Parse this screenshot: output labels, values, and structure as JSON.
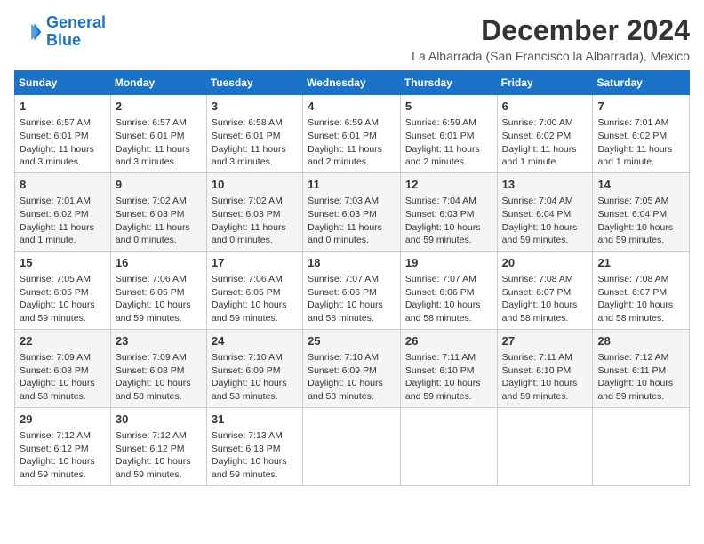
{
  "header": {
    "logo_line1": "General",
    "logo_line2": "Blue",
    "month_title": "December 2024",
    "location": "La Albarrada (San Francisco la Albarrada), Mexico"
  },
  "weekdays": [
    "Sunday",
    "Monday",
    "Tuesday",
    "Wednesday",
    "Thursday",
    "Friday",
    "Saturday"
  ],
  "weeks": [
    [
      {
        "day": "1",
        "sunrise": "6:57 AM",
        "sunset": "6:01 PM",
        "daylight": "11 hours and 3 minutes."
      },
      {
        "day": "2",
        "sunrise": "6:57 AM",
        "sunset": "6:01 PM",
        "daylight": "11 hours and 3 minutes."
      },
      {
        "day": "3",
        "sunrise": "6:58 AM",
        "sunset": "6:01 PM",
        "daylight": "11 hours and 3 minutes."
      },
      {
        "day": "4",
        "sunrise": "6:59 AM",
        "sunset": "6:01 PM",
        "daylight": "11 hours and 2 minutes."
      },
      {
        "day": "5",
        "sunrise": "6:59 AM",
        "sunset": "6:01 PM",
        "daylight": "11 hours and 2 minutes."
      },
      {
        "day": "6",
        "sunrise": "7:00 AM",
        "sunset": "6:02 PM",
        "daylight": "11 hours and 1 minute."
      },
      {
        "day": "7",
        "sunrise": "7:01 AM",
        "sunset": "6:02 PM",
        "daylight": "11 hours and 1 minute."
      }
    ],
    [
      {
        "day": "8",
        "sunrise": "7:01 AM",
        "sunset": "6:02 PM",
        "daylight": "11 hours and 1 minute."
      },
      {
        "day": "9",
        "sunrise": "7:02 AM",
        "sunset": "6:03 PM",
        "daylight": "11 hours and 0 minutes."
      },
      {
        "day": "10",
        "sunrise": "7:02 AM",
        "sunset": "6:03 PM",
        "daylight": "11 hours and 0 minutes."
      },
      {
        "day": "11",
        "sunrise": "7:03 AM",
        "sunset": "6:03 PM",
        "daylight": "11 hours and 0 minutes."
      },
      {
        "day": "12",
        "sunrise": "7:04 AM",
        "sunset": "6:03 PM",
        "daylight": "10 hours and 59 minutes."
      },
      {
        "day": "13",
        "sunrise": "7:04 AM",
        "sunset": "6:04 PM",
        "daylight": "10 hours and 59 minutes."
      },
      {
        "day": "14",
        "sunrise": "7:05 AM",
        "sunset": "6:04 PM",
        "daylight": "10 hours and 59 minutes."
      }
    ],
    [
      {
        "day": "15",
        "sunrise": "7:05 AM",
        "sunset": "6:05 PM",
        "daylight": "10 hours and 59 minutes."
      },
      {
        "day": "16",
        "sunrise": "7:06 AM",
        "sunset": "6:05 PM",
        "daylight": "10 hours and 59 minutes."
      },
      {
        "day": "17",
        "sunrise": "7:06 AM",
        "sunset": "6:05 PM",
        "daylight": "10 hours and 59 minutes."
      },
      {
        "day": "18",
        "sunrise": "7:07 AM",
        "sunset": "6:06 PM",
        "daylight": "10 hours and 58 minutes."
      },
      {
        "day": "19",
        "sunrise": "7:07 AM",
        "sunset": "6:06 PM",
        "daylight": "10 hours and 58 minutes."
      },
      {
        "day": "20",
        "sunrise": "7:08 AM",
        "sunset": "6:07 PM",
        "daylight": "10 hours and 58 minutes."
      },
      {
        "day": "21",
        "sunrise": "7:08 AM",
        "sunset": "6:07 PM",
        "daylight": "10 hours and 58 minutes."
      }
    ],
    [
      {
        "day": "22",
        "sunrise": "7:09 AM",
        "sunset": "6:08 PM",
        "daylight": "10 hours and 58 minutes."
      },
      {
        "day": "23",
        "sunrise": "7:09 AM",
        "sunset": "6:08 PM",
        "daylight": "10 hours and 58 minutes."
      },
      {
        "day": "24",
        "sunrise": "7:10 AM",
        "sunset": "6:09 PM",
        "daylight": "10 hours and 58 minutes."
      },
      {
        "day": "25",
        "sunrise": "7:10 AM",
        "sunset": "6:09 PM",
        "daylight": "10 hours and 58 minutes."
      },
      {
        "day": "26",
        "sunrise": "7:11 AM",
        "sunset": "6:10 PM",
        "daylight": "10 hours and 59 minutes."
      },
      {
        "day": "27",
        "sunrise": "7:11 AM",
        "sunset": "6:10 PM",
        "daylight": "10 hours and 59 minutes."
      },
      {
        "day": "28",
        "sunrise": "7:12 AM",
        "sunset": "6:11 PM",
        "daylight": "10 hours and 59 minutes."
      }
    ],
    [
      {
        "day": "29",
        "sunrise": "7:12 AM",
        "sunset": "6:12 PM",
        "daylight": "10 hours and 59 minutes."
      },
      {
        "day": "30",
        "sunrise": "7:12 AM",
        "sunset": "6:12 PM",
        "daylight": "10 hours and 59 minutes."
      },
      {
        "day": "31",
        "sunrise": "7:13 AM",
        "sunset": "6:13 PM",
        "daylight": "10 hours and 59 minutes."
      },
      null,
      null,
      null,
      null
    ]
  ]
}
